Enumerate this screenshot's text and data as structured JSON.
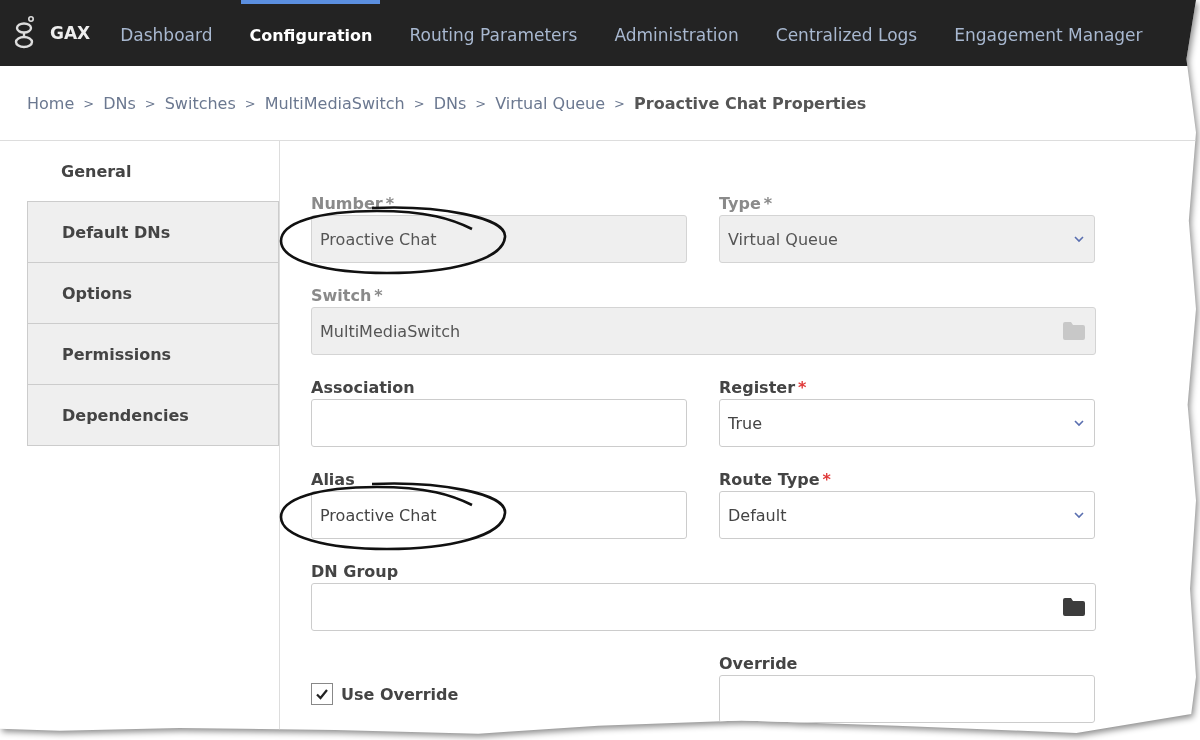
{
  "navbar": {
    "logo_text": "GAX",
    "items": [
      {
        "label": "Dashboard",
        "selected": false
      },
      {
        "label": "Configuration",
        "selected": true
      },
      {
        "label": "Routing Parameters",
        "selected": false
      },
      {
        "label": "Administration",
        "selected": false
      },
      {
        "label": "Centralized Logs",
        "selected": false
      },
      {
        "label": "Engagement Manager",
        "selected": false
      }
    ]
  },
  "breadcrumb": {
    "separator": ">",
    "items": [
      "Home",
      "DNs",
      "Switches",
      "MultiMediaSwitch",
      "DNs",
      "Virtual Queue"
    ],
    "current": "Proactive Chat Properties"
  },
  "side_tabs": [
    {
      "label": "General",
      "selected": true
    },
    {
      "label": "Default DNs",
      "selected": false
    },
    {
      "label": "Options",
      "selected": false
    },
    {
      "label": "Permissions",
      "selected": false
    },
    {
      "label": "Dependencies",
      "selected": false
    }
  ],
  "form": {
    "rows": [
      [
        {
          "kind": "text",
          "label": "Number",
          "required_mark": "*",
          "disabled": true,
          "value": "Proactive Chat",
          "circled": true
        },
        {
          "kind": "select",
          "label": "Type",
          "required_mark": "*",
          "disabled": true,
          "value": "Virtual Queue",
          "circled": false
        }
      ],
      [
        {
          "kind": "browse",
          "label": "Switch",
          "required_mark": "*",
          "disabled": true,
          "value": "MultiMediaSwitch",
          "circled": false
        }
      ],
      [
        {
          "kind": "text",
          "label": "Association",
          "disabled": false,
          "circled": false
        },
        {
          "kind": "select",
          "label": "Register",
          "required_mark": "*",
          "disabled": false,
          "value": "True",
          "circled": false
        }
      ],
      [
        {
          "kind": "text",
          "label": "Alias",
          "disabled": false,
          "value": "Proactive Chat",
          "circled": true
        },
        {
          "kind": "select",
          "label": "Route Type",
          "required_mark": "*",
          "disabled": false,
          "value": "Default",
          "circled": false
        }
      ],
      [
        {
          "kind": "browse",
          "label": "DN Group",
          "disabled": false,
          "circled": false
        }
      ],
      [
        {
          "kind": "checkbox",
          "label": "Use Override",
          "checked": true
        },
        {
          "kind": "text",
          "label": "Override",
          "disabled": false,
          "circled": false
        }
      ]
    ]
  }
}
